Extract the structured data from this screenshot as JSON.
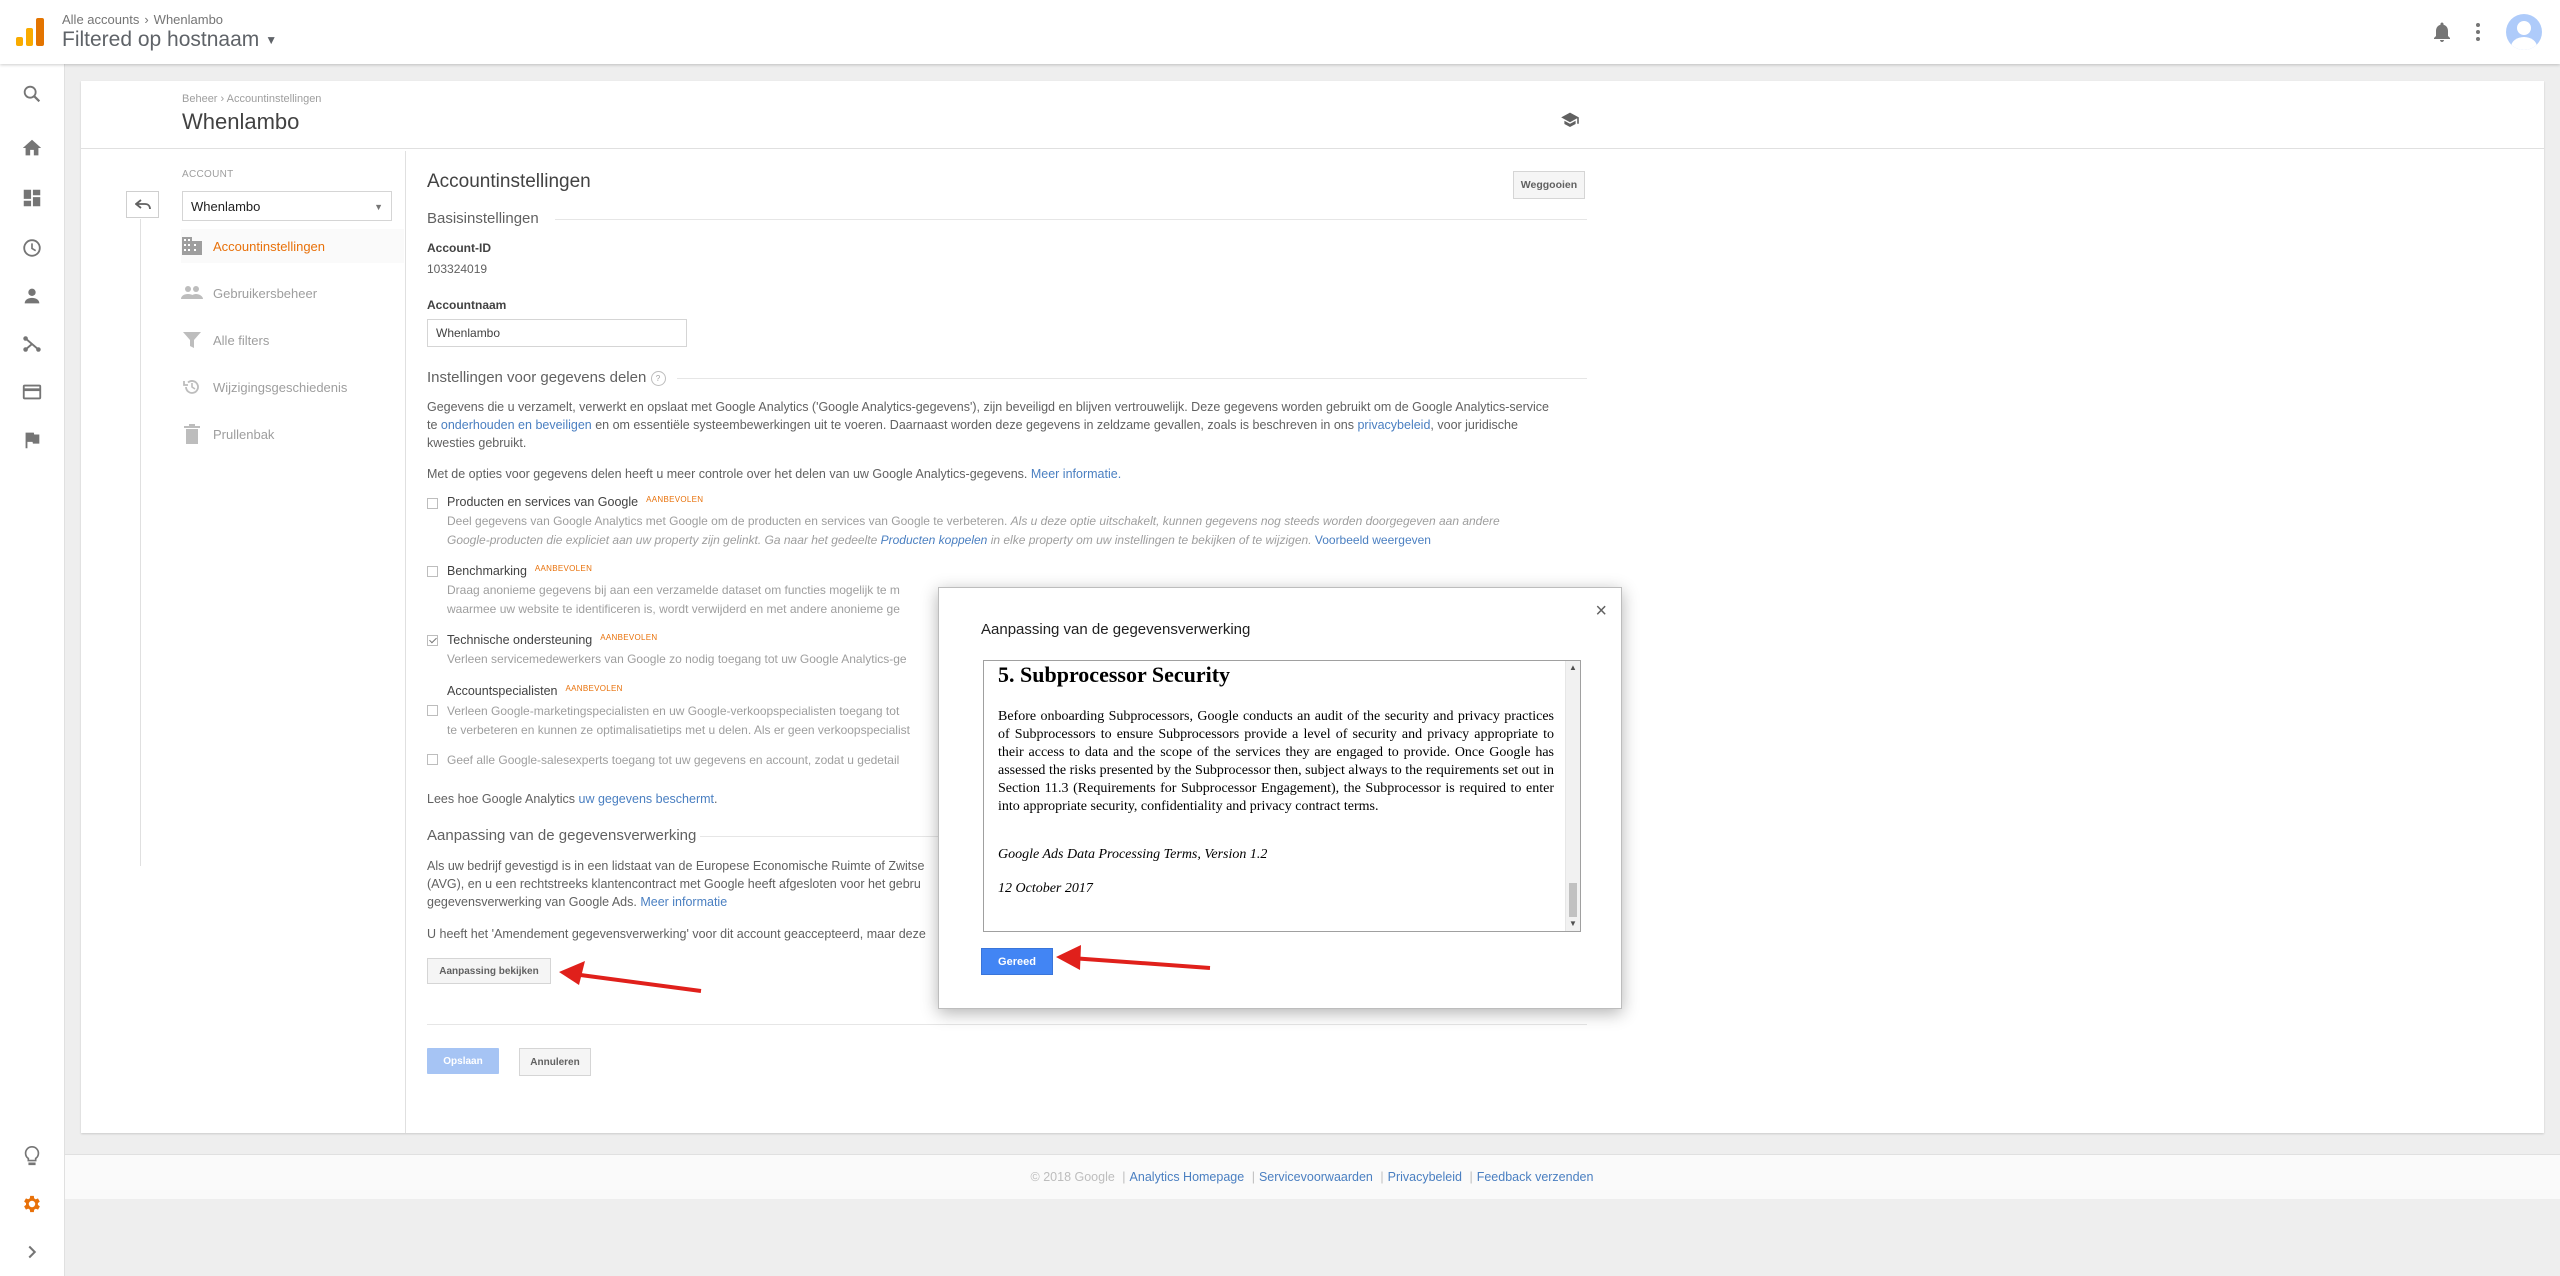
{
  "header": {
    "breadcrumb": [
      "Alle accounts",
      "Whenlambo"
    ],
    "breadcrumb_sep": "›",
    "view_title": "Filtered op hostnaam"
  },
  "rail": {
    "icons": [
      "search-icon",
      "home-icon",
      "dashboard-icon",
      "clock-icon",
      "person-icon",
      "share-icon",
      "display-icon",
      "flag-icon",
      "lightbulb-icon",
      "gear-icon",
      "chevron-right-icon"
    ]
  },
  "page": {
    "breadcrumb": "Beheer › Accountinstellingen",
    "title": "Whenlambo"
  },
  "account_col": {
    "label": "ACCOUNT",
    "selected": "Whenlambo",
    "nav": [
      {
        "label": "Accountinstellingen",
        "icon": "building-icon",
        "active": true
      },
      {
        "label": "Gebruikersbeheer",
        "icon": "users-icon",
        "active": false
      },
      {
        "label": "Alle filters",
        "icon": "filter-icon",
        "active": false
      },
      {
        "label": "Wijzigingsgeschiedenis",
        "icon": "history-icon",
        "active": false
      },
      {
        "label": "Prullenbak",
        "icon": "trash-icon",
        "active": false
      }
    ]
  },
  "settings": {
    "title": "Accountinstellingen",
    "discard_label": "Weggooien",
    "basic_heading": "Basisinstellingen",
    "account_id_label": "Account-ID",
    "account_id": "103324019",
    "account_name_label": "Accountnaam",
    "account_name": "Whenlambo",
    "sharing_heading": "Instellingen voor gegevens delen",
    "sharing_help": "?",
    "sharing_intro_1": "Gegevens die u verzamelt, verwerkt en opslaat met Google Analytics ('Google Analytics-gegevens'), zijn beveiligd en blijven vertrouwelijk. Deze gegevens worden gebruikt om de Google Analytics-service",
    "sharing_intro_2a": "te ",
    "sharing_intro_link1": "onderhouden en beveiligen",
    "sharing_intro_2b": " en om essentiële systeembewerkingen uit te voeren. Daarnaast worden deze gegevens in zeldzame gevallen, zoals is beschreven in ons ",
    "sharing_intro_link2": "privacybeleid",
    "sharing_intro_2c": ", voor juridische",
    "sharing_intro_3": "kwesties gebruikt.",
    "sharing_more_text": "Met de opties voor gegevens delen heeft u meer controle over het delen van uw Google Analytics-gegevens. ",
    "sharing_more_link": "Meer informatie.",
    "recommended": "AANBEVOLEN",
    "opt1_title": "Producten en services van Google",
    "opt1_desc1a": "Deel gegevens van Google Analytics met Google om de producten en services van Google te verbeteren. ",
    "opt1_desc1b": "Als u deze optie uitschakelt, kunnen gegevens nog steeds worden doorgegeven aan andere",
    "opt1_desc2a": "Google-producten die expliciet aan uw property zijn gelinkt. Ga naar het gedeelte ",
    "opt1_desc2_link": "Producten koppelen",
    "opt1_desc2b": " in elke property om uw instellingen te bekijken of te wijzigen. ",
    "opt1_example": "Voorbeeld weergeven",
    "opt2_title": "Benchmarking",
    "opt2_desc1": "Draag anonieme gegevens bij aan een verzamelde dataset om functies mogelijk te m",
    "opt2_desc2": "waarmee uw website te identificeren is, wordt verwijderd en met andere anonieme ge",
    "opt3_title": "Technische ondersteuning",
    "opt3_desc1": "Verleen servicemedewerkers van Google zo nodig toegang tot uw Google Analytics-ge",
    "opt4_title": "Accountspecialisten",
    "opt4_desc1": "Verleen Google-marketingspecialisten en uw Google-verkoopspecialisten toegang tot",
    "opt4_desc2": "te verbeteren en kunnen ze optimalisatietips met u delen. Als er geen verkoopspecialist",
    "opt5_desc1": "Geef alle Google-salesexperts toegang tot uw gegevens en account, zodat u gedetail",
    "protect_text": "Lees hoe Google Analytics ",
    "protect_link": "uw gegevens beschermt",
    "protect_end": ".",
    "dpa_heading": "Aanpassing van de gegevensverwerking",
    "dpa_text1": "Als uw bedrijf gevestigd is in een lidstaat van de Europese Economische Ruimte of Zwitse",
    "dpa_text2": "(AVG), en u een rechtstreeks klantencontract met Google heeft afgesloten voor het gebru",
    "dpa_text3a": "gegevensverwerking van Google Ads. ",
    "dpa_text3_link": "Meer informatie",
    "dpa_accepted": "U heeft het 'Amendement gegevensverwerking' voor dit account geaccepteerd, maar deze",
    "dpa_view_btn": "Aanpassing bekijken",
    "save_btn": "Opslaan",
    "cancel_btn": "Annuleren"
  },
  "footer": {
    "copyright": "© 2018 Google",
    "links": [
      "Analytics Homepage",
      "Servicevoorwaarden",
      "Privacybeleid",
      "Feedback verzenden"
    ],
    "sep": "|"
  },
  "modal": {
    "title": "Aanpassing van de gegevensverwerking",
    "close": "×",
    "doc_heading": "5. Subprocessor Security",
    "doc_paragraph": "Before onboarding Subprocessors, Google conducts an audit of the security and privacy practices of Subprocessors to ensure Subprocessors provide a level of security and privacy appropriate to their access to data and the scope of the services they are engaged to provide. Once Google has assessed the risks presented by the Subprocessor then, subject always to the requirements set out in Section 11.3 (Requirements for Subprocessor Engagement), the Subprocessor is required to enter into appropriate security, confidentiality and privacy contract terms.",
    "doc_version": "Google Ads Data Processing Terms, Version 1.2",
    "doc_date": "12 October 2017",
    "done_label": "Gereed",
    "scroll_up": "▲",
    "scroll_down": "▼"
  },
  "colors": {
    "accent_orange": "#e8710a",
    "link_blue": "#4a7fc1",
    "primary_blue": "#4285f4",
    "arrow_red": "#e0201b"
  }
}
